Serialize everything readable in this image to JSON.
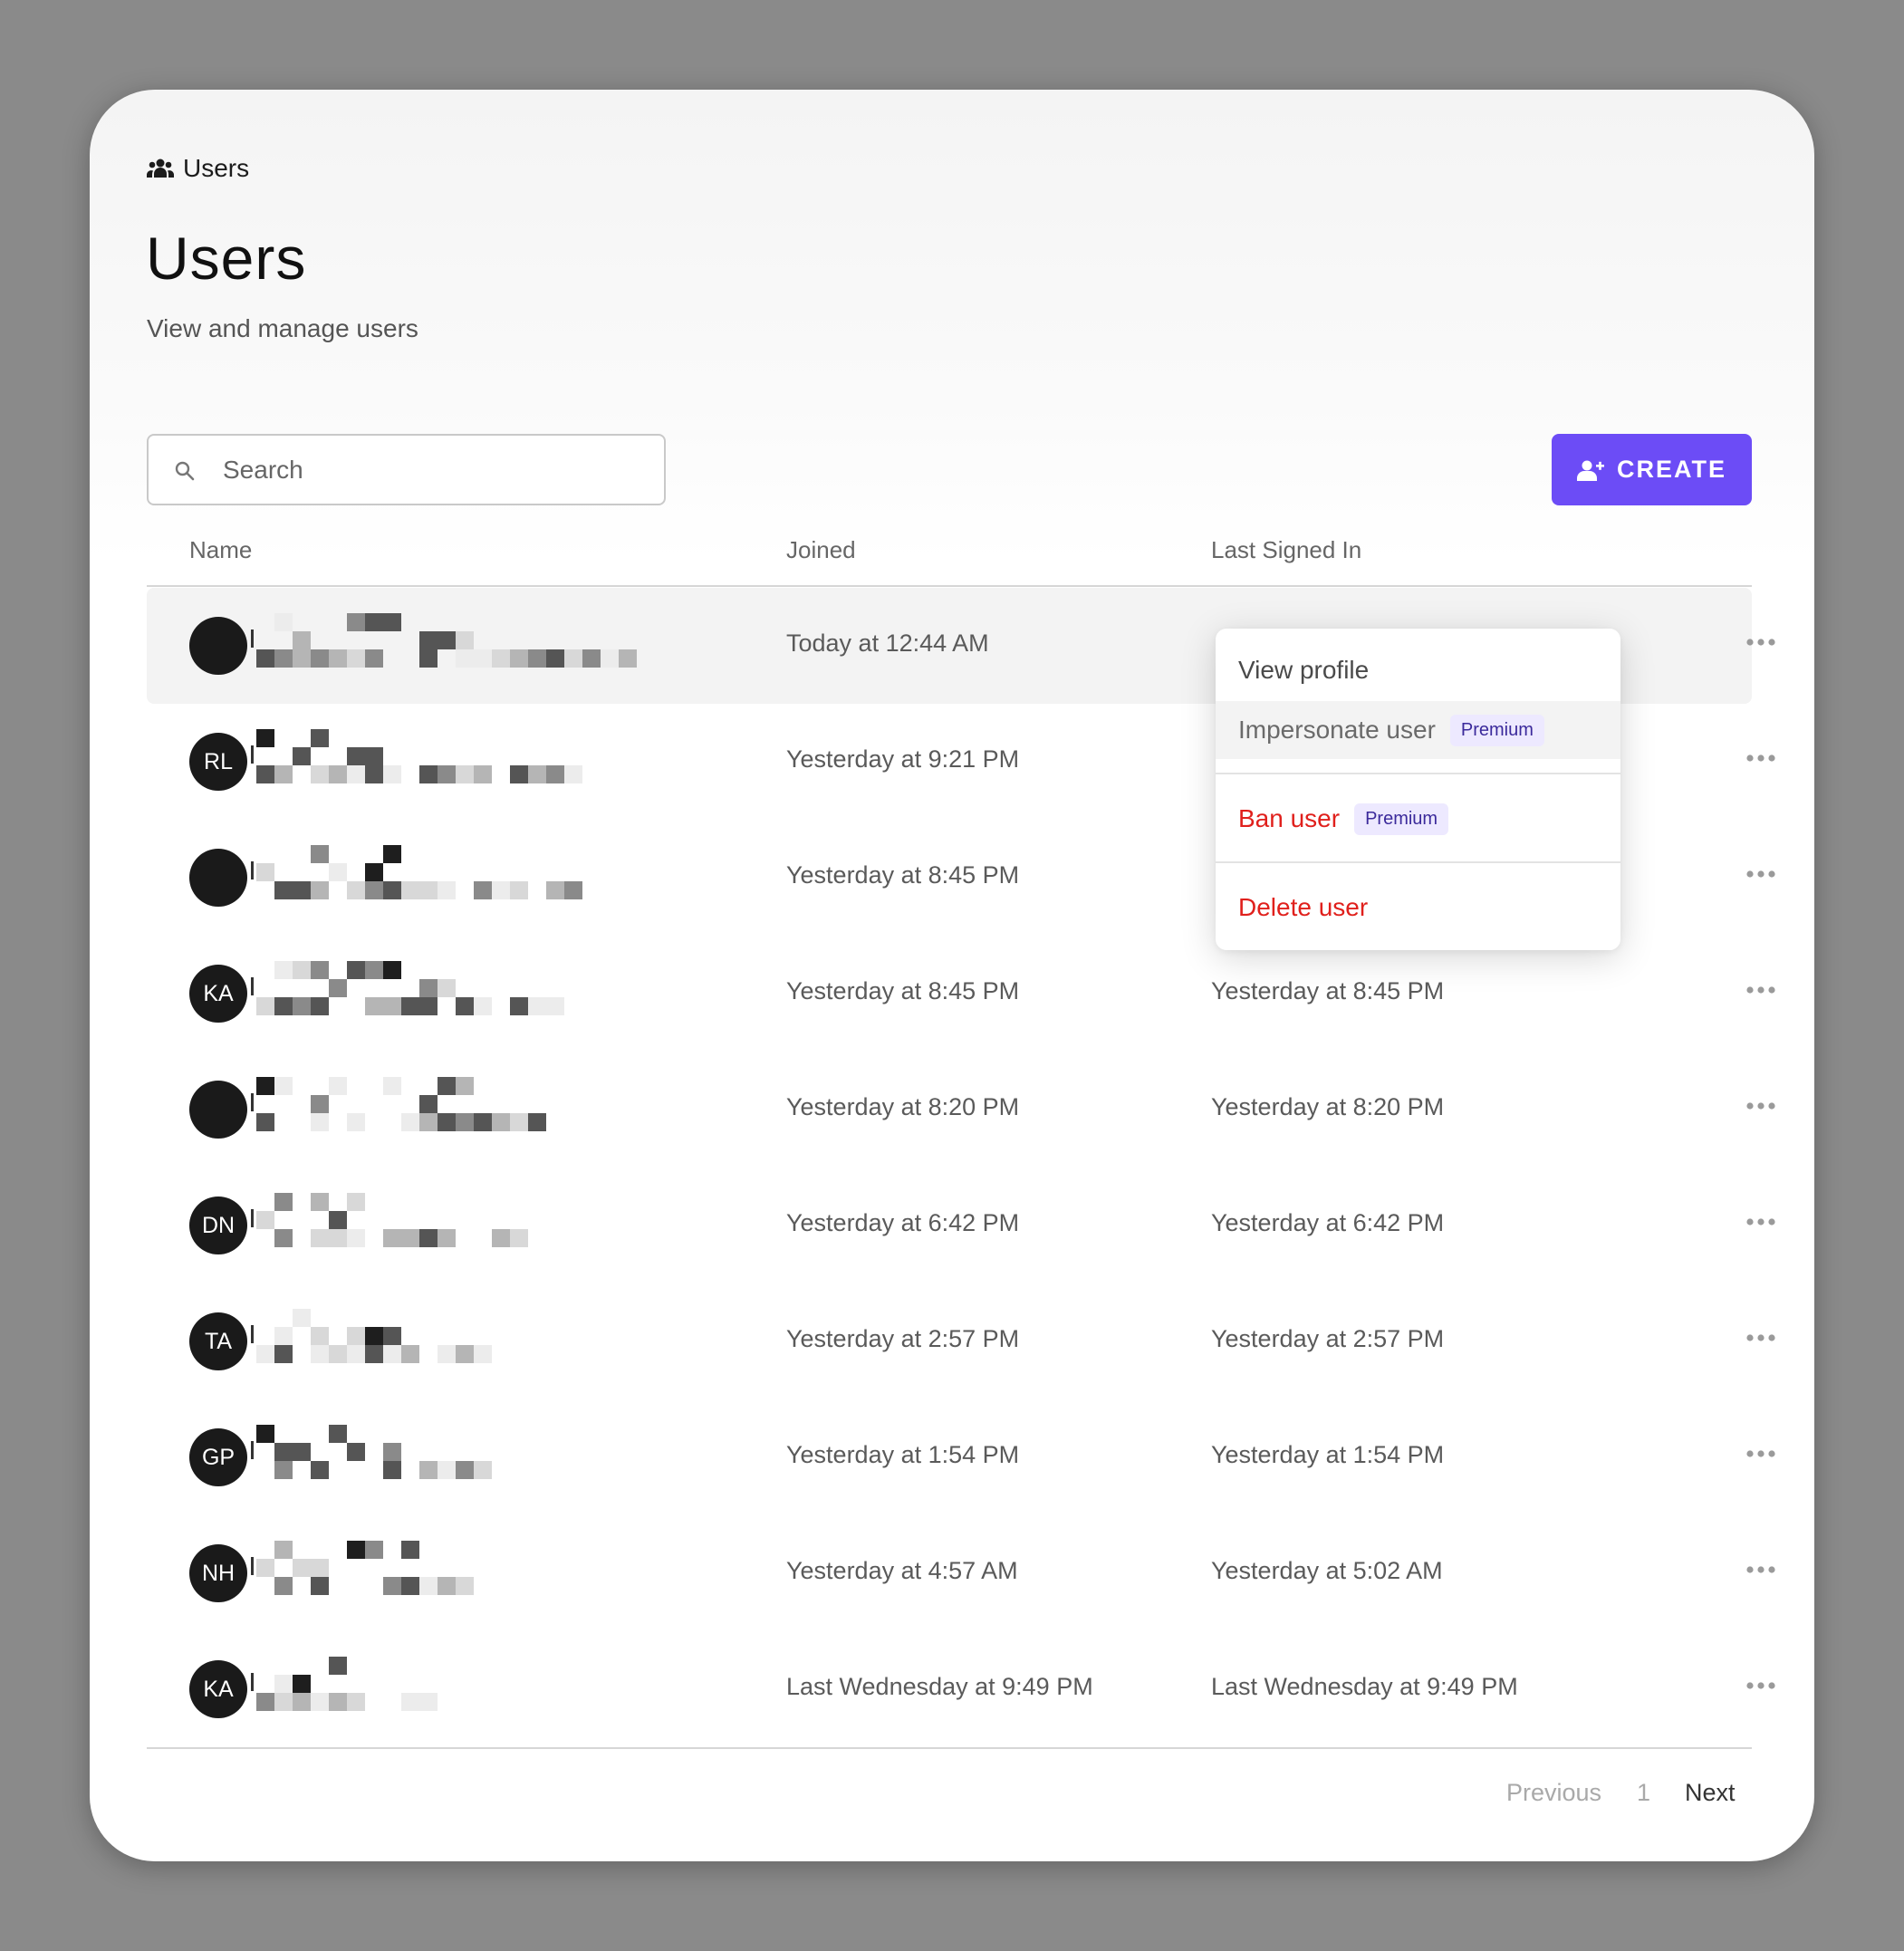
{
  "breadcrumb": {
    "label": "Users"
  },
  "page": {
    "title": "Users",
    "subtitle": "View and manage users"
  },
  "search": {
    "placeholder": "Search",
    "value": ""
  },
  "toolbar": {
    "create_label": "CREATE"
  },
  "table": {
    "columns": [
      "Name",
      "Joined",
      "Last Signed In"
    ],
    "rows": [
      {
        "initials": "",
        "joined": "Today at 12:44 AM",
        "last_signed_in": ""
      },
      {
        "initials": "RL",
        "joined": "Yesterday at 9:21 PM",
        "last_signed_in": ""
      },
      {
        "initials": "",
        "joined": "Yesterday at 8:45 PM",
        "last_signed_in": ""
      },
      {
        "initials": "KA",
        "joined": "Yesterday at 8:45 PM",
        "last_signed_in": "Yesterday at 8:45 PM"
      },
      {
        "initials": "",
        "joined": "Yesterday at 8:20 PM",
        "last_signed_in": "Yesterday at 8:20 PM"
      },
      {
        "initials": "DN",
        "joined": "Yesterday at 6:42 PM",
        "last_signed_in": "Yesterday at 6:42 PM"
      },
      {
        "initials": "TA",
        "joined": "Yesterday at 2:57 PM",
        "last_signed_in": "Yesterday at 2:57 PM"
      },
      {
        "initials": "GP",
        "joined": "Yesterday at 1:54 PM",
        "last_signed_in": "Yesterday at 1:54 PM"
      },
      {
        "initials": "NH",
        "joined": "Yesterday at 4:57 AM",
        "last_signed_in": "Yesterday at 5:02 AM"
      },
      {
        "initials": "KA",
        "joined": "Last Wednesday at 9:49 PM",
        "last_signed_in": "Last Wednesday at 9:49 PM"
      }
    ]
  },
  "context_menu": {
    "view_profile": "View profile",
    "impersonate": "Impersonate user",
    "impersonate_badge": "Premium",
    "ban": "Ban user",
    "ban_badge": "Premium",
    "delete": "Delete user"
  },
  "pagination": {
    "previous": "Previous",
    "page": "1",
    "next": "Next"
  },
  "colors": {
    "accent": "#6c4cf6",
    "danger": "#e0201c",
    "badge_bg": "#ede9ff",
    "badge_text": "#3b2a9b"
  }
}
